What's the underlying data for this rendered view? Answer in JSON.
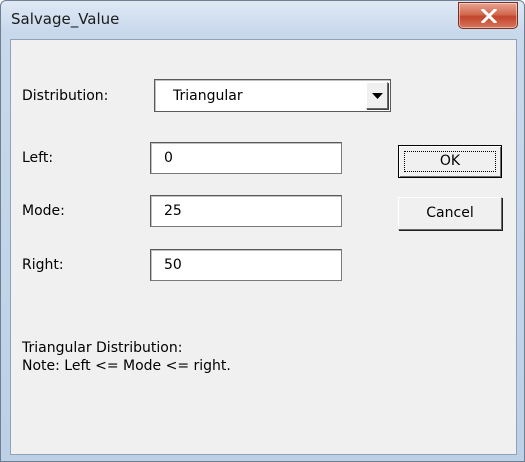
{
  "window": {
    "title": "Salvage_Value",
    "close_label": "X"
  },
  "distribution": {
    "label": "Distribution:",
    "selected": "Triangular"
  },
  "fields": {
    "left": {
      "label": "Left:",
      "value": "0"
    },
    "mode": {
      "label": "Mode:",
      "value": "25"
    },
    "right": {
      "label": "Right:",
      "value": "50"
    }
  },
  "buttons": {
    "ok": "OK",
    "cancel": "Cancel"
  },
  "note": {
    "line1": "Triangular Distribution:",
    "line2": "Note: Left <= Mode <= right."
  },
  "icons": {
    "close": "close-icon",
    "dropdown": "chevron-down-icon"
  }
}
